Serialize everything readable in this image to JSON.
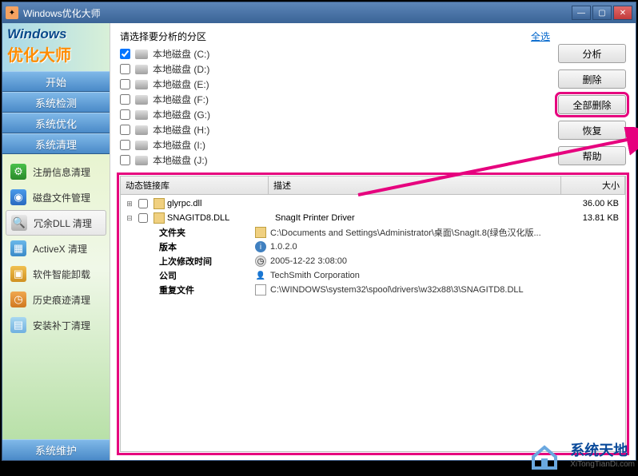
{
  "titlebar": {
    "title": "Windows优化大师"
  },
  "logo": {
    "line1": "Windows",
    "line2": "优化大师"
  },
  "top_tabs": [
    "开始",
    "系统检测",
    "系统优化",
    "系统清理"
  ],
  "nav_items": [
    {
      "icon": "ic-reg",
      "label": "注册信息清理"
    },
    {
      "icon": "ic-disk",
      "label": "磁盘文件管理"
    },
    {
      "icon": "ic-dll",
      "label": "冗余DLL 清理",
      "active": true
    },
    {
      "icon": "ic-ax",
      "label": "ActiveX 清理"
    },
    {
      "icon": "ic-soft",
      "label": "软件智能卸载"
    },
    {
      "icon": "ic-hist",
      "label": "历史痕迹清理"
    },
    {
      "icon": "ic-patch",
      "label": "安装补丁清理"
    }
  ],
  "bottom_tab": "系统维护",
  "partition": {
    "header": "请选择要分析的分区",
    "select_all": "全选",
    "drives": [
      {
        "label": "本地磁盘 (C:)",
        "checked": true
      },
      {
        "label": "本地磁盘 (D:)",
        "checked": false
      },
      {
        "label": "本地磁盘 (E:)",
        "checked": false
      },
      {
        "label": "本地磁盘 (F:)",
        "checked": false
      },
      {
        "label": "本地磁盘 (G:)",
        "checked": false
      },
      {
        "label": "本地磁盘 (H:)",
        "checked": false
      },
      {
        "label": "本地磁盘 (I:)",
        "checked": false
      },
      {
        "label": "本地磁盘 (J:)",
        "checked": false
      }
    ]
  },
  "actions": {
    "analyze": "分析",
    "delete": "删除",
    "delete_all": "全部删除",
    "restore": "恢复",
    "help": "帮助"
  },
  "results": {
    "columns": {
      "name": "动态链接库",
      "desc": "描述",
      "size": "大小"
    },
    "rows": [
      {
        "tree": "+",
        "name": "glyrpc.dll",
        "desc": "",
        "size": "36.00 KB"
      },
      {
        "tree": "−",
        "name": "SNAGITD8.DLL",
        "desc": "SnagIt Printer Driver",
        "size": "13.81 KB"
      }
    ],
    "details": {
      "folder_label": "文件夹",
      "folder_value": "C:\\Documents and Settings\\Administrator\\桌面\\SnagIt.8(绿色汉化版...",
      "version_label": "版本",
      "version_value": "1.0.2.0",
      "modified_label": "上次修改时间",
      "modified_value": "2005-12-22 3:08:00",
      "company_label": "公司",
      "company_value": "TechSmith Corporation",
      "dupfile_label": "重复文件",
      "dupfile_value": "C:\\WINDOWS\\system32\\spool\\drivers\\w32x88\\3\\SNAGITD8.DLL"
    }
  },
  "watermark": {
    "line1": "系统天地",
    "line2": "XiTongTianDi.com"
  }
}
